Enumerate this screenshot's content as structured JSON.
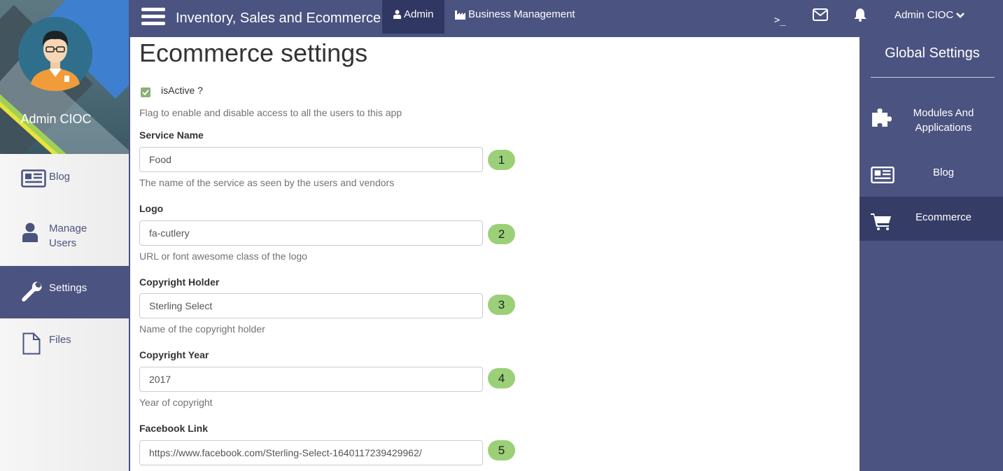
{
  "topbar": {
    "app_title": "Inventory, Sales and Ecommerce",
    "admin_tab": "Admin",
    "business_tab": "Business Management",
    "terminal_glyph": ">_",
    "user_menu": "Admin CIOC",
    "icons": [
      "hamburger-icon",
      "user-icon",
      "factory-icon",
      "terminal-icon",
      "mail-icon",
      "bell-icon",
      "chevron-down-icon"
    ]
  },
  "left_sidebar": {
    "profile_name": "Admin CIOC",
    "items": [
      {
        "label": "Blog",
        "icon": "newspaper-icon"
      },
      {
        "label": "Manage Users",
        "icon": "user-icon"
      },
      {
        "label": "Settings",
        "icon": "wrench-icon",
        "active": true
      },
      {
        "label": "Files",
        "icon": "file-icon"
      }
    ]
  },
  "right_sidebar": {
    "title": "Global Settings",
    "items": [
      {
        "label": "Modules And Applications",
        "icon": "puzzle-icon"
      },
      {
        "label": "Blog",
        "icon": "newspaper-icon"
      },
      {
        "label": "Ecommerce",
        "icon": "cart-icon",
        "active": true
      }
    ]
  },
  "main": {
    "title": "Ecommerce settings",
    "active_toggle": {
      "label": "isActive ?",
      "checked": true,
      "help": "Flag to enable and disable access to all the users to this app"
    },
    "fields": [
      {
        "label": "Service Name",
        "value": "Food",
        "help": "The name of the service as seen by the users and vendors",
        "badge": "1"
      },
      {
        "label": "Logo",
        "value": "fa-cutlery",
        "help": "URL or font awesome class of the logo",
        "badge": "2"
      },
      {
        "label": "Copyright Holder",
        "value": "Sterling Select",
        "help": "Name of the copyright holder",
        "badge": "3"
      },
      {
        "label": "Copyright Year",
        "value": "2017",
        "help": "Year of copyright",
        "badge": "4"
      },
      {
        "label": "Facebook Link",
        "value": "https://www.facebook.com/Sterling-Select-1640117239429962/",
        "help": "",
        "badge": "5"
      }
    ]
  },
  "colors": {
    "nav_primary": "#4b5380",
    "nav_active_dark": "#2f3762",
    "badge_green": "#9bd078",
    "checkbox_green": "#8bb07a"
  }
}
